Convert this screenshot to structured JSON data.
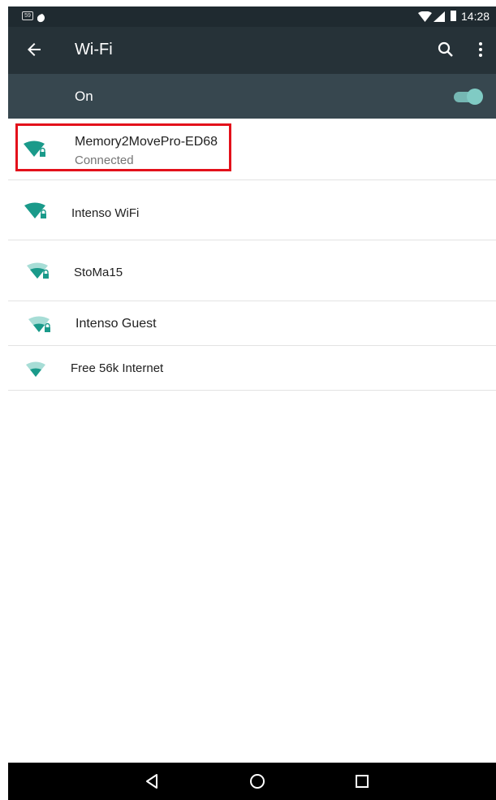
{
  "status_bar": {
    "badge": "59",
    "time": "14:28"
  },
  "app_bar": {
    "title": "Wi-Fi"
  },
  "master_switch": {
    "label": "On",
    "state_on": true
  },
  "networks": [
    {
      "name": "Memory2MovePro-ED68",
      "status": "Connected",
      "secured": true,
      "signal_level": 4
    },
    {
      "name": "Intenso WiFi",
      "status": "",
      "secured": true,
      "signal_level": 4
    },
    {
      "name": "StoMa15",
      "status": "",
      "secured": true,
      "signal_level": 3
    },
    {
      "name": "Intenso Guest",
      "status": "",
      "secured": true,
      "signal_level": 2
    },
    {
      "name": "Free 56k Internet",
      "status": "",
      "secured": false,
      "signal_level": 2
    }
  ],
  "colors": {
    "accent": "#1a9a8a",
    "status_bar": "#1f2a30",
    "app_bar": "#263238",
    "switch_row": "#37474f",
    "highlight": "#e3111b"
  },
  "icons": {
    "back": "arrow-left-icon",
    "search": "search-icon",
    "more": "more-vert-icon",
    "wifi": "wifi-icon",
    "lock": "lock-icon"
  }
}
